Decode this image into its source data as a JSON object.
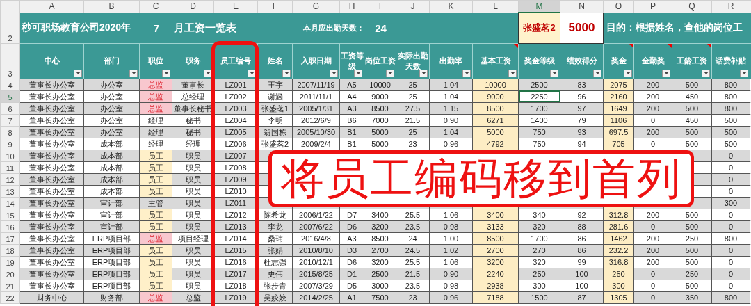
{
  "column_letters": [
    {
      "label": "A",
      "selected": false
    },
    {
      "label": "B",
      "selected": false
    },
    {
      "label": "C",
      "selected": false
    },
    {
      "label": "D",
      "selected": false
    },
    {
      "label": "E",
      "selected": false
    },
    {
      "label": "F",
      "selected": false
    },
    {
      "label": "G",
      "selected": false
    },
    {
      "label": "H",
      "selected": false
    },
    {
      "label": "I",
      "selected": false
    },
    {
      "label": "J",
      "selected": false
    },
    {
      "label": "K",
      "selected": false
    },
    {
      "label": "L",
      "selected": false
    },
    {
      "label": "M",
      "selected": true
    },
    {
      "label": "N",
      "selected": false
    },
    {
      "label": "O",
      "selected": false
    },
    {
      "label": "P",
      "selected": false
    },
    {
      "label": "Q",
      "selected": false
    },
    {
      "label": "R",
      "selected": false
    }
  ],
  "title_row": {
    "row_number": "2",
    "title": "秒可职场教育公司2020年",
    "month": "7",
    "title_suffix": "月工资一览表",
    "attendance_label": "本月应出勤天数：",
    "attendance_days": "24",
    "lookup_name": "张盛茗2",
    "lookup_result": "5000",
    "purpose": "目的：根据姓名，查他的岗位工"
  },
  "header_row": {
    "row_number": "3",
    "columns": [
      {
        "label": "中心",
        "tinted": false,
        "comment": false
      },
      {
        "label": "部门",
        "tinted": false,
        "comment": false
      },
      {
        "label": "职位",
        "tinted": false,
        "comment": false
      },
      {
        "label": "职务",
        "tinted": false,
        "comment": false
      },
      {
        "label": "员工编号",
        "tinted": false,
        "comment": false
      },
      {
        "label": "姓名",
        "tinted": false,
        "comment": false
      },
      {
        "label": "入职日期",
        "tinted": false,
        "comment": false
      },
      {
        "label": "工资等级",
        "tinted": false,
        "comment": false
      },
      {
        "label": "岗位工资",
        "tinted": false,
        "comment": false
      },
      {
        "label": "实际出勤天数",
        "tinted": false,
        "comment": false
      },
      {
        "label": "出勤率",
        "tinted": false,
        "comment": false
      },
      {
        "label": "基本工资",
        "tinted": true,
        "comment": true
      },
      {
        "label": "奖金等级",
        "tinted": false,
        "comment": false
      },
      {
        "label": "绩效得分",
        "tinted": false,
        "comment": false
      },
      {
        "label": "奖金",
        "tinted": true,
        "comment": true
      },
      {
        "label": "全勤奖",
        "tinted": false,
        "comment": true
      },
      {
        "label": "工龄工资",
        "tinted": false,
        "comment": true
      },
      {
        "label": "话费补贴",
        "tinted": false,
        "comment": false
      }
    ]
  },
  "rows": [
    {
      "row_number": "4",
      "selected": false,
      "kind": "director",
      "cells": [
        "董事长办公室",
        "办公室",
        "总监",
        "董事长",
        "LZ001",
        "王宇",
        "2007/11/19",
        "A5",
        "10000",
        "25",
        "1.04",
        "10000",
        "2500",
        "83",
        "2075",
        "200",
        "500",
        "800"
      ]
    },
    {
      "row_number": "5",
      "selected": true,
      "kind": "director",
      "cells": [
        "董事长办公室",
        "办公室",
        "总监",
        "总经理",
        "LZ002",
        "谢涵",
        "2011/11/1",
        "A4",
        "9000",
        "25",
        "1.04",
        "9000",
        "2250",
        "96",
        "2160",
        "200",
        "450",
        "800"
      ]
    },
    {
      "row_number": "6",
      "selected": false,
      "kind": "director",
      "cells": [
        "董事长办公室",
        "办公室",
        "总监",
        "董事长秘书",
        "LZ003",
        "张盛茗1",
        "2005/1/31",
        "A3",
        "8500",
        "27.5",
        "1.15",
        "8500",
        "1700",
        "97",
        "1649",
        "200",
        "500",
        "800"
      ]
    },
    {
      "row_number": "7",
      "selected": false,
      "kind": "other",
      "cells": [
        "董事长办公室",
        "办公室",
        "经理",
        "秘书",
        "LZ004",
        "李明",
        "2012/6/9",
        "B6",
        "7000",
        "21.5",
        "0.90",
        "6271",
        "1400",
        "79",
        "1106",
        "0",
        "450",
        "500"
      ]
    },
    {
      "row_number": "8",
      "selected": false,
      "kind": "other",
      "cells": [
        "董事长办公室",
        "办公室",
        "经理",
        "秘书",
        "LZ005",
        "翁国栋",
        "2005/10/30",
        "B1",
        "5000",
        "25",
        "1.04",
        "5000",
        "750",
        "93",
        "697.5",
        "200",
        "500",
        "500"
      ]
    },
    {
      "row_number": "9",
      "selected": false,
      "kind": "other",
      "cells": [
        "董事长办公室",
        "成本部",
        "经理",
        "经理",
        "LZ006",
        "张盛茗2",
        "2009/2/4",
        "B1",
        "5000",
        "23",
        "0.96",
        "4792",
        "750",
        "94",
        "705",
        "0",
        "500",
        "500"
      ]
    },
    {
      "row_number": "10",
      "selected": false,
      "kind": "staff",
      "cells": [
        "董事长办公室",
        "成本部",
        "员工",
        "职员",
        "LZ007",
        null,
        null,
        null,
        null,
        null,
        null,
        null,
        null,
        null,
        null,
        null,
        null,
        "0"
      ]
    },
    {
      "row_number": "11",
      "selected": false,
      "kind": "staff",
      "cells": [
        "董事长办公室",
        "成本部",
        "员工",
        "职员",
        "LZ008",
        null,
        null,
        null,
        null,
        null,
        null,
        null,
        null,
        null,
        null,
        null,
        null,
        "0"
      ]
    },
    {
      "row_number": "12",
      "selected": false,
      "kind": "staff",
      "cells": [
        "董事长办公室",
        "成本部",
        "员工",
        "职员",
        "LZ009",
        null,
        null,
        null,
        null,
        null,
        null,
        null,
        null,
        null,
        null,
        null,
        null,
        "0"
      ]
    },
    {
      "row_number": "13",
      "selected": false,
      "kind": "staff",
      "cells": [
        "董事长办公室",
        "成本部",
        "员工",
        "职员",
        "LZ010",
        null,
        null,
        null,
        null,
        null,
        null,
        null,
        null,
        null,
        null,
        null,
        null,
        "0"
      ]
    },
    {
      "row_number": "14",
      "selected": false,
      "kind": "other",
      "cells": [
        "董事长办公室",
        "审计部",
        "主管",
        "职员",
        "LZ011",
        null,
        null,
        null,
        null,
        null,
        null,
        null,
        null,
        null,
        null,
        null,
        null,
        "300"
      ]
    },
    {
      "row_number": "15",
      "selected": false,
      "kind": "staff",
      "cells": [
        "董事长办公室",
        "审计部",
        "员工",
        "职员",
        "LZ012",
        "陈希龙",
        "2006/1/22",
        "D7",
        "3400",
        "25.5",
        "1.06",
        "3400",
        "340",
        "92",
        "312.8",
        "200",
        "500",
        "0"
      ]
    },
    {
      "row_number": "16",
      "selected": false,
      "kind": "staff",
      "cells": [
        "董事长办公室",
        "审计部",
        "员工",
        "职员",
        "LZ013",
        "李龙",
        "2007/6/22",
        "D6",
        "3200",
        "23.5",
        "0.98",
        "3133",
        "320",
        "88",
        "281.6",
        "0",
        "500",
        "0"
      ]
    },
    {
      "row_number": "17",
      "selected": false,
      "kind": "director",
      "cells": [
        "董事长办公室",
        "ERP项目部",
        "总监",
        "项目经理",
        "LZ014",
        "桑玮",
        "2016/4/8",
        "A3",
        "8500",
        "24",
        "1.00",
        "8500",
        "1700",
        "86",
        "1462",
        "200",
        "250",
        "800"
      ]
    },
    {
      "row_number": "18",
      "selected": false,
      "kind": "staff",
      "cells": [
        "董事长办公室",
        "ERP项目部",
        "员工",
        "职员",
        "LZ015",
        "张娟",
        "2010/8/10",
        "D3",
        "2700",
        "24.5",
        "1.02",
        "2700",
        "270",
        "86",
        "232.2",
        "200",
        "500",
        "0"
      ]
    },
    {
      "row_number": "19",
      "selected": false,
      "kind": "staff",
      "cells": [
        "董事长办公室",
        "ERP项目部",
        "员工",
        "职员",
        "LZ016",
        "杜志强",
        "2010/12/1",
        "D6",
        "3200",
        "25.5",
        "1.06",
        "3200",
        "320",
        "99",
        "316.8",
        "200",
        "500",
        "0"
      ]
    },
    {
      "row_number": "20",
      "selected": false,
      "kind": "staff",
      "cells": [
        "董事长办公室",
        "ERP项目部",
        "员工",
        "职员",
        "LZ017",
        "史伟",
        "2015/8/25",
        "D1",
        "2500",
        "21.5",
        "0.90",
        "2240",
        "250",
        "100",
        "250",
        "0",
        "250",
        "0"
      ]
    },
    {
      "row_number": "21",
      "selected": false,
      "kind": "staff",
      "cells": [
        "董事长办公室",
        "ERP项目部",
        "员工",
        "职员",
        "LZ018",
        "张步青",
        "2007/3/29",
        "D5",
        "3000",
        "23.5",
        "0.98",
        "2938",
        "300",
        "100",
        "300",
        "0",
        "500",
        "0"
      ]
    },
    {
      "row_number": "22",
      "selected": false,
      "kind": "director",
      "cells": [
        "财务中心",
        "财务部",
        "总监",
        "总监",
        "LZ019",
        "吴姣姣",
        "2014/2/25",
        "A1",
        "7500",
        "23",
        "0.96",
        "7188",
        "1500",
        "87",
        "1305",
        "0",
        "350",
        "800"
      ]
    }
  ],
  "overlay": {
    "caption": "将员工编码移到首列"
  }
}
